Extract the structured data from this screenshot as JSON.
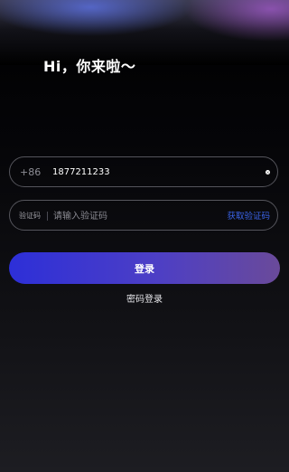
{
  "header": {
    "greeting": "Hi，你来啦～"
  },
  "phone_field": {
    "prefix": "+86",
    "value": "1877211233",
    "clear_icon": "clear-icon"
  },
  "code_field": {
    "label": "验证码",
    "placeholder": "请输入验证码",
    "get_code_label": "获取验证码"
  },
  "actions": {
    "login_label": "登录",
    "password_login_label": "密码登录"
  },
  "colors": {
    "accent_blue": "#3a63e8",
    "button_gradient_start": "#2d2fd8",
    "button_gradient_end": "#6a4a9a"
  }
}
